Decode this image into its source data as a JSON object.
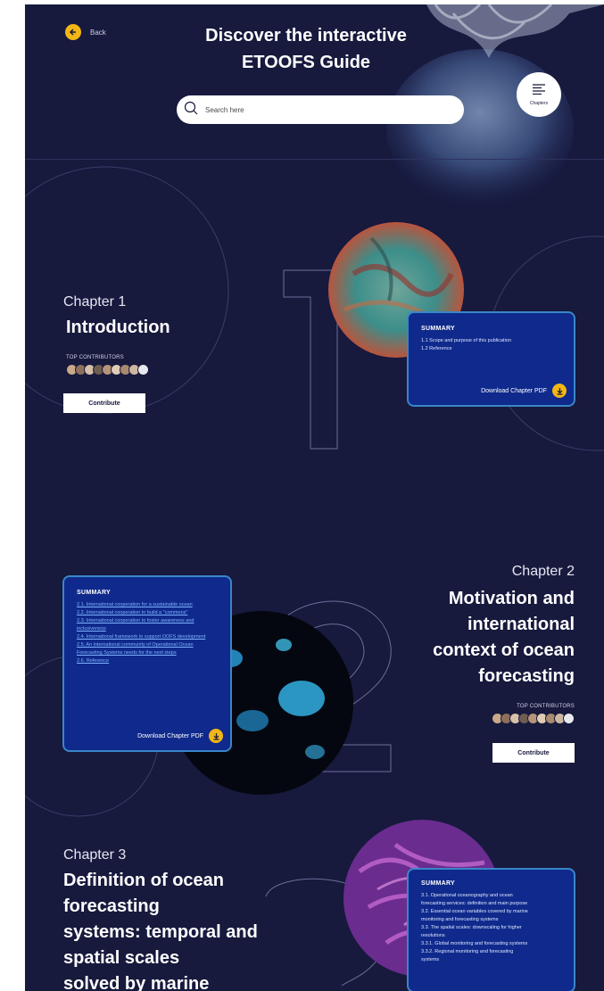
{
  "header": {
    "back_label": "Back",
    "title_line1": "Discover the interactive",
    "title_line2": "ETOOFS Guide",
    "search_placeholder": "Search here",
    "chapters_label": "Chapters"
  },
  "chapters": [
    {
      "label": "Chapter 1",
      "title": "Introduction",
      "top_contributors_label": "TOP CONTRIBUTORS",
      "contribute_label": "Contribute",
      "summary_heading": "SUMMARY",
      "summary_items": [
        "1.1 Scope and purpose of this publication",
        "1.2 Reference"
      ],
      "download_label": "Download Chapter PDF"
    },
    {
      "label": "Chapter 2",
      "title_lines": [
        "Motivation and",
        "international",
        "context of ocean",
        "forecasting"
      ],
      "top_contributors_label": "TOP CONTRIBUTORS",
      "contribute_label": "Contribute",
      "summary_heading": "SUMMARY",
      "summary_items": [
        "2.1. International cooperation for a sustainable ocean",
        "2.2. International cooperation to build a \"commons\"",
        "2.3. International cooperation to foster awareness and inclusiveness",
        "2.4. International framework to support OOFS development",
        "2.5. An international community of Operational Ocean Forecasting Systems needs for the next steps",
        "2.6. Reference"
      ],
      "download_label": "Download Chapter PDF"
    },
    {
      "label": "Chapter 3",
      "title_lines": [
        "Definition of ocean",
        "forecasting",
        "systems: temporal and",
        "spatial scales",
        "solved by marine"
      ],
      "summary_heading": "SUMMARY",
      "summary_items": [
        "3.1. Operational oceanography and ocean",
        "forecasting services: definition and main purpose",
        "3.2. Essential ocean variables covered by marine",
        "monitoring and forecasting systems",
        "3.3. The spatial scales: downscaling for higher",
        "resolutions",
        "3.3.1. Global monitoring and forecasting systems",
        "3.3.2. Regional monitoring and forecasting",
        "systems"
      ]
    }
  ],
  "colors": {
    "background": "#17193d",
    "accent": "#f2b615",
    "summary_bg": "#0f2a8c",
    "summary_border": "#3a86c8"
  }
}
